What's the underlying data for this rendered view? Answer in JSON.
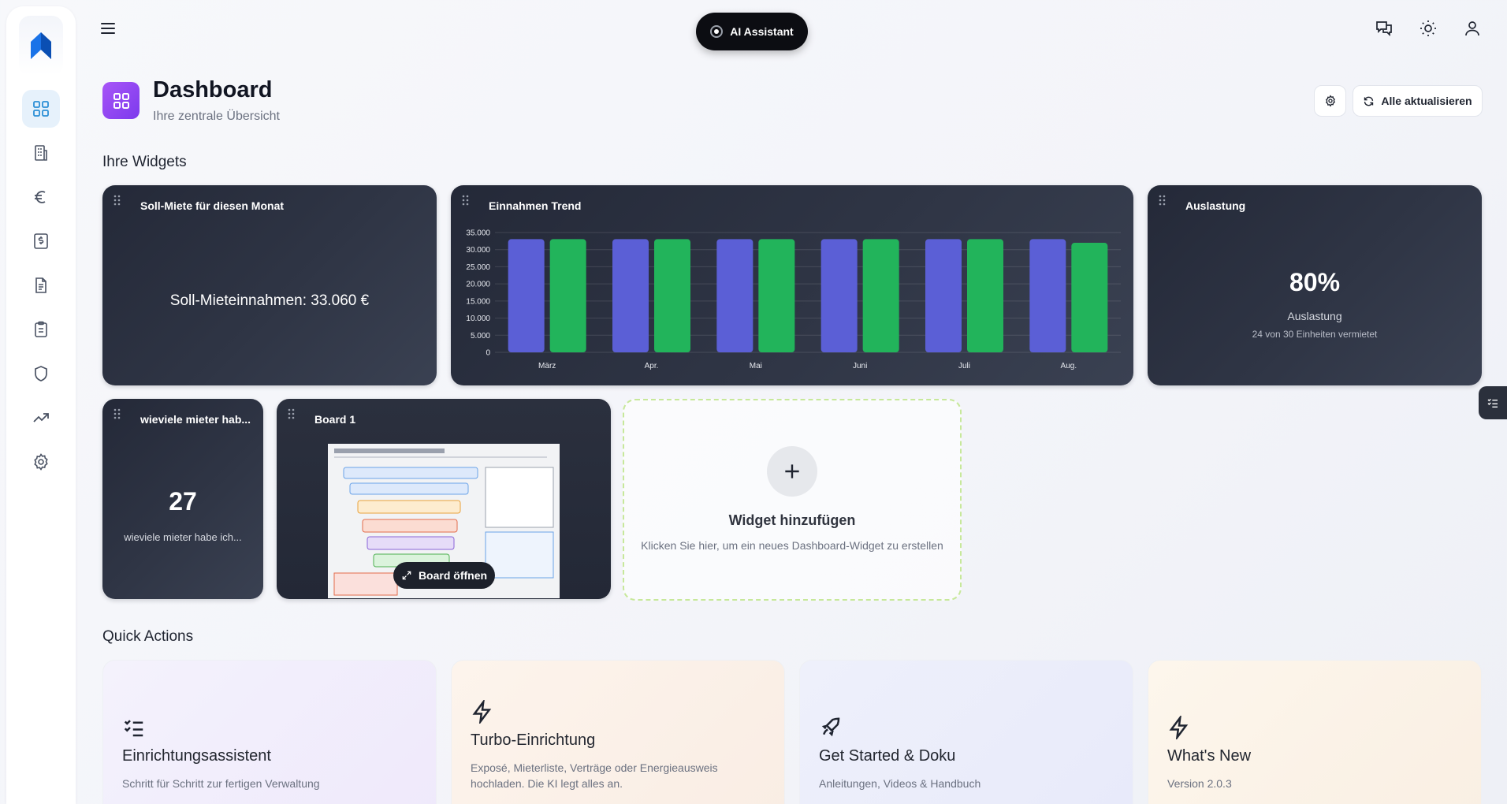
{
  "topbar": {
    "ai_button_label": "AI Assistant",
    "icons": [
      "menu-icon",
      "chat-icon",
      "sun-icon",
      "user-icon"
    ]
  },
  "sidebar": {
    "items": [
      {
        "name": "dashboard",
        "icon": "dashboard-grid-icon",
        "active": true
      },
      {
        "name": "properties",
        "icon": "building-icon",
        "active": false
      },
      {
        "name": "finance",
        "icon": "euro-icon",
        "active": false
      },
      {
        "name": "payments",
        "icon": "dollar-document-icon",
        "active": false
      },
      {
        "name": "documents",
        "icon": "document-icon",
        "active": false
      },
      {
        "name": "tasks",
        "icon": "clipboard-icon",
        "active": false
      },
      {
        "name": "insurance",
        "icon": "shield-icon",
        "active": false
      },
      {
        "name": "analytics",
        "icon": "trending-up-icon",
        "active": false
      },
      {
        "name": "settings",
        "icon": "gear-icon",
        "active": false
      }
    ]
  },
  "header": {
    "title": "Dashboard",
    "subtitle": "Ihre zentrale Übersicht",
    "refresh_label": "Alle aktualisieren"
  },
  "sections": {
    "widgets_title": "Ihre Widgets",
    "quick_actions_title": "Quick Actions"
  },
  "widgets": {
    "soll_miete": {
      "title": "Soll-Miete für diesen Monat",
      "text": "Soll-Mieteinnahmen: 33.060 €"
    },
    "einnahmen": {
      "title": "Einnahmen Trend"
    },
    "auslastung": {
      "title": "Auslastung",
      "value": "80%",
      "label": "Auslastung",
      "sub": "24 von 30 Einheiten vermietet",
      "fraction": 0.8
    },
    "mieter": {
      "title": "wieviele mieter hab...",
      "value": "27",
      "sub": "wieviele mieter habe ich..."
    },
    "board": {
      "title": "Board 1",
      "open_label": "Board öffnen"
    },
    "add": {
      "title": "Widget hinzufügen",
      "sub": "Klicken Sie hier, um ein neues Dashboard-Widget zu erstellen"
    }
  },
  "chart_data": {
    "type": "bar",
    "categories": [
      "März",
      "Apr.",
      "Mai",
      "Juni",
      "Juli",
      "Aug."
    ],
    "series": [
      {
        "values": [
          33060,
          33060,
          33060,
          33060,
          33060,
          33060
        ],
        "color": "#5b5fd6"
      },
      {
        "values": [
          33060,
          33060,
          33060,
          33060,
          33060,
          32000
        ],
        "color": "#22b45b"
      }
    ],
    "ylim": [
      0,
      35000
    ],
    "yticks": [
      "0",
      "5.000",
      "10.000",
      "15.000",
      "20.000",
      "25.000",
      "30.000",
      "35.000"
    ],
    "ytick_values": [
      0,
      5000,
      10000,
      15000,
      20000,
      25000,
      30000,
      35000
    ],
    "grid": true
  },
  "quick_actions": [
    {
      "title": "Einrichtungsassistent",
      "sub": "Schritt für Schritt zur fertigen Verwaltung",
      "icon": "checklist-icon",
      "bg": "#f1eefb"
    },
    {
      "title": "Turbo-Einrichtung",
      "sub": "Exposé, Mieterliste, Verträge oder Energieausweis hochladen. Die KI legt alles an.",
      "icon": "lightning-icon",
      "bg": "#fbf1ea"
    },
    {
      "title": "Get Started & Doku",
      "sub": "Anleitungen, Videos & Handbuch",
      "icon": "rocket-icon",
      "bg": "#eceefb"
    },
    {
      "title": "What's New",
      "sub": "Version 2.0.3",
      "icon": "lightning-icon",
      "bg": "#fbf3ea"
    }
  ],
  "colors": {
    "accent": "#2b8fd6",
    "page_icon": "#8b46f0",
    "widget_bg": "#2a2f3d",
    "bar_blue": "#5b5fd6",
    "bar_green": "#22b45b",
    "add_border": "#c7e89a"
  }
}
